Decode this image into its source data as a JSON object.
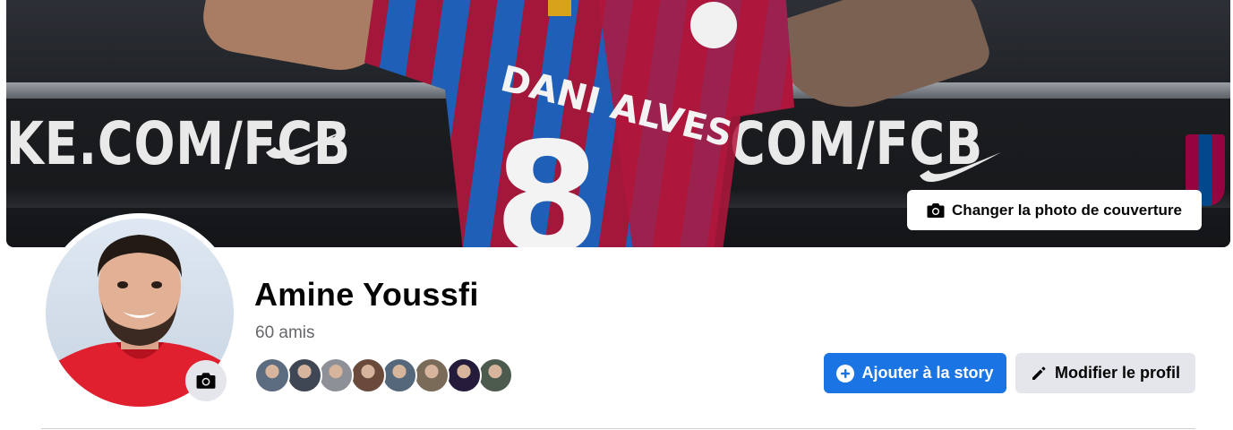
{
  "cover": {
    "banner_text_left": "KE.COM/FCB",
    "banner_text_right": "COM/FCB",
    "jersey_name": "DANI ALVES",
    "jersey_number": "8",
    "change_cover_label": "Changer la photo de couverture"
  },
  "profile": {
    "name": "Amine Youssfi",
    "friends_count": "60 amis",
    "friend_avatar_colors": [
      "#5b6b80",
      "#3f4654",
      "#8d9096",
      "#6a4a3a",
      "#55677a",
      "#7a6a58",
      "#241c3a",
      "#4d5b4e"
    ]
  },
  "actions": {
    "add_story_label": "Ajouter à la story",
    "edit_profile_label": "Modifier le profil"
  },
  "colors": {
    "accent": "#1b74e4",
    "secondary_button": "#e4e6eb",
    "text_primary": "#050505",
    "text_secondary": "#65676b"
  }
}
